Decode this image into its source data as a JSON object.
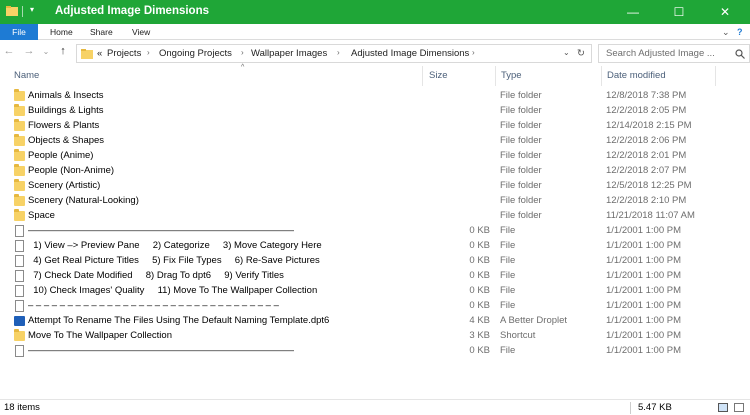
{
  "window": {
    "title": "Adjusted Image Dimensions",
    "controls": {
      "minimize": "—",
      "maximize": "☐",
      "close": "✕"
    }
  },
  "ribbon": {
    "tabs": [
      "File",
      "Home",
      "Share",
      "View"
    ]
  },
  "address": {
    "overflow": "«",
    "crumbs": [
      "Projects",
      "Ongoing Projects",
      "Wallpaper Images",
      "Adjusted Image Dimensions"
    ],
    "sep": "›"
  },
  "search": {
    "placeholder": "Search   Adjusted Image ..."
  },
  "columns": {
    "name": "Name",
    "size": "Size",
    "type": "Type",
    "date": "Date modified",
    "sort_indicator": "^"
  },
  "rows": [
    {
      "icon": "folder-icon",
      "name": "Animals & Insects",
      "size": "",
      "type": "File folder",
      "date": "12/8/2018 7:38 PM"
    },
    {
      "icon": "folder-icon",
      "name": "Buildings & Lights",
      "size": "",
      "type": "File folder",
      "date": "12/2/2018 2:05 PM"
    },
    {
      "icon": "folder-icon",
      "name": "Flowers & Plants",
      "size": "",
      "type": "File folder",
      "date": "12/14/2018 2:15 PM"
    },
    {
      "icon": "folder-icon",
      "name": "Objects & Shapes",
      "size": "",
      "type": "File folder",
      "date": "12/2/2018 2:06 PM"
    },
    {
      "icon": "folder-icon",
      "name": "People (Anime)",
      "size": "",
      "type": "File folder",
      "date": "12/2/2018 2:01 PM"
    },
    {
      "icon": "folder-icon",
      "name": "People (Non-Anime)",
      "size": "",
      "type": "File folder",
      "date": "12/2/2018 2:07 PM"
    },
    {
      "icon": "folder-icon",
      "name": "Scenery (Artistic)",
      "size": "",
      "type": "File folder",
      "date": "12/5/2018 12:25 PM"
    },
    {
      "icon": "folder-icon",
      "name": "Scenery (Natural-Looking)",
      "size": "",
      "type": "File folder",
      "date": "12/2/2018 2:10 PM"
    },
    {
      "icon": "folder-icon",
      "name": "Space",
      "size": "",
      "type": "File folder",
      "date": "11/21/2018 11:07 AM"
    },
    {
      "icon": "file-icon",
      "name": "————————————————————————————",
      "size": "0 KB",
      "type": "File",
      "date": "1/1/2001 1:00 PM"
    },
    {
      "icon": "file-icon",
      "name": "  1) View –> Preview Pane     2) Categorize     3) Move Category Here",
      "size": "0 KB",
      "type": "File",
      "date": "1/1/2001 1:00 PM"
    },
    {
      "icon": "file-icon",
      "name": "  4) Get Real Picture Titles     5) Fix File Types     6) Re-Save Pictures",
      "size": "0 KB",
      "type": "File",
      "date": "1/1/2001 1:00 PM"
    },
    {
      "icon": "file-icon",
      "name": "  7) Check Date Modified     8) Drag To dpt6     9) Verify Titles",
      "size": "0 KB",
      "type": "File",
      "date": "1/1/2001 1:00 PM"
    },
    {
      "icon": "file-icon",
      "name": "  10) Check Images' Quality     11) Move To The Wallpaper Collection",
      "size": "0 KB",
      "type": "File",
      "date": "1/1/2001 1:00 PM"
    },
    {
      "icon": "file-icon",
      "name": "– – – – – – – – – – – – – – – – – – – – – – – – – – – – – – – –",
      "size": "0 KB",
      "type": "File",
      "date": "1/1/2001 1:00 PM"
    },
    {
      "icon": "dpt6-file-icon",
      "name": "Attempt To Rename The Files Using The Default Naming Template.dpt6",
      "size": "4 KB",
      "type": "A Better Droplet",
      "date": "1/1/2001 1:00 PM"
    },
    {
      "icon": "folder-icon",
      "name": "Move To The Wallpaper Collection",
      "size": "3 KB",
      "type": "Shortcut",
      "date": "1/1/2001 1:00 PM"
    },
    {
      "icon": "file-icon",
      "name": "————————————————————————————",
      "size": "0 KB",
      "type": "File",
      "date": "1/1/2001 1:00 PM"
    }
  ],
  "status": {
    "items": "18 items",
    "selected_size": "5.47 KB"
  },
  "colors": {
    "titlebar": "#1fa637",
    "file_tab": "#1e7bd4",
    "folder": "#f7d266"
  }
}
